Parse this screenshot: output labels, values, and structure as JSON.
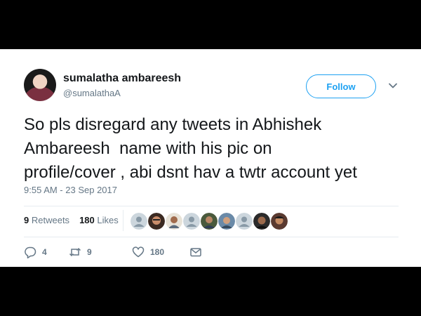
{
  "user": {
    "display_name": "sumalatha ambareesh",
    "handle": "@sumalathaA"
  },
  "follow_label": "Follow",
  "tweet": {
    "text": "So pls disregard any tweets in Abhishek\nAmbareesh  name with his pic on\nprofile/cover , abi dsnt hav a twtr account yet",
    "timestamp": "9:55 AM - 23 Sep 2017"
  },
  "stats": {
    "retweets_count": "9",
    "retweets_label": "Retweets",
    "likes_count": "180",
    "likes_label": "Likes"
  },
  "actions": {
    "reply_count": "4",
    "retweet_count": "9",
    "like_count": "180"
  },
  "colors": {
    "accent": "#1da1f2",
    "text": "#14171a",
    "muted": "#657786",
    "border": "#e6ecf0"
  },
  "icons": [
    "chevron-down-icon",
    "reply-icon",
    "retweet-icon",
    "like-icon",
    "message-icon"
  ]
}
